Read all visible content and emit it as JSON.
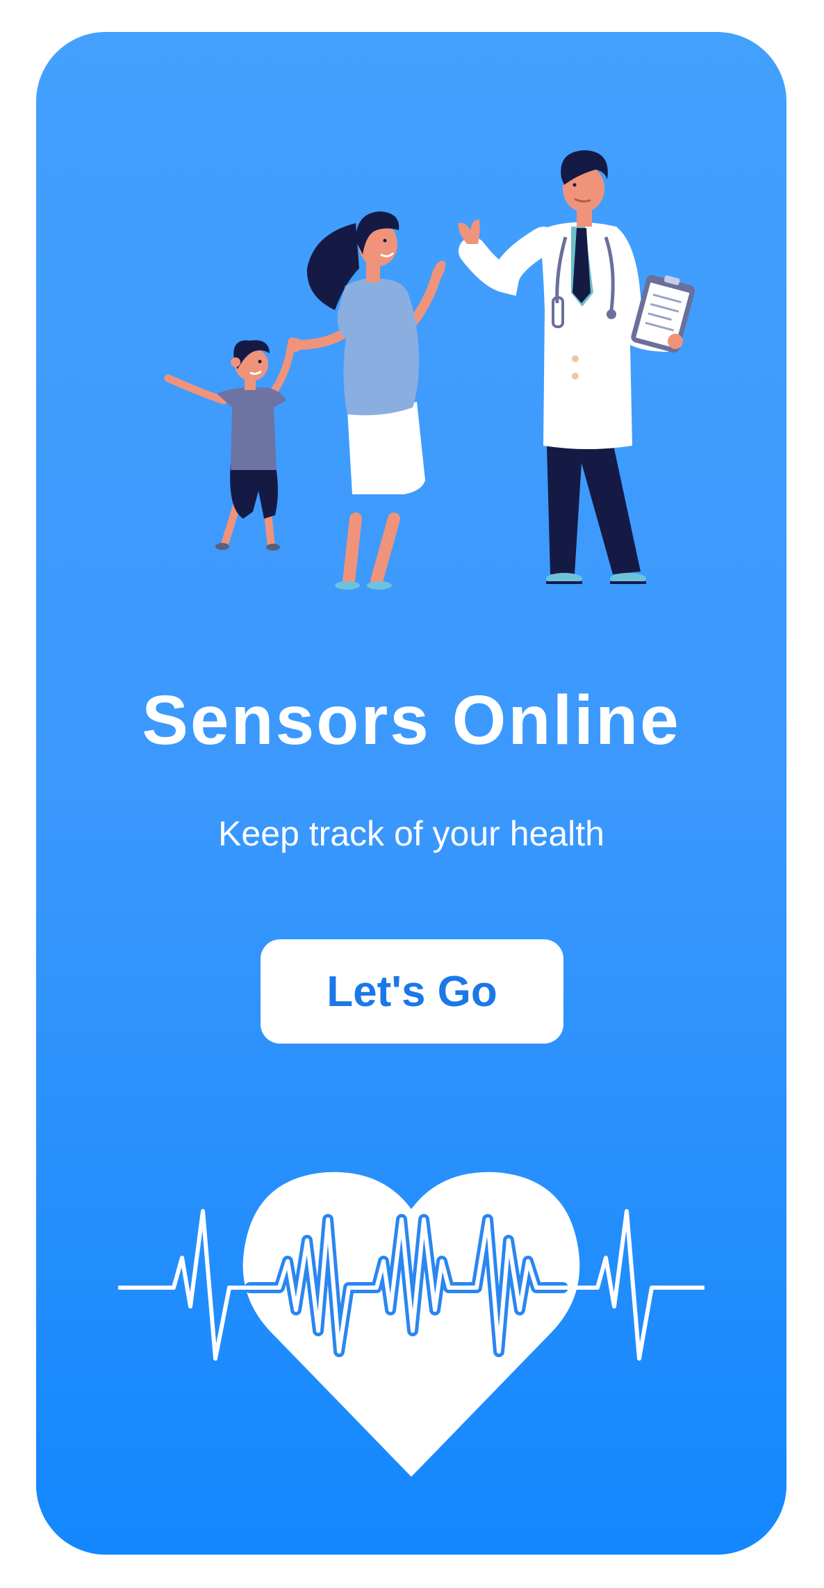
{
  "app": {
    "title": "Sensors Online",
    "subtitle": "Keep track of your health",
    "cta_label": "Let's Go"
  },
  "illustration": {
    "subject": "family-with-doctor",
    "icons": [
      "child-figure",
      "mother-figure",
      "doctor-figure",
      "stethoscope-icon",
      "clipboard-icon"
    ]
  },
  "footer_graphic": {
    "icons": [
      "heart-icon",
      "heartbeat-line-icon"
    ]
  },
  "colors": {
    "background_top": "#43a0fd",
    "background_bottom": "#1387fd",
    "text": "#ffffff",
    "button_background": "#ffffff",
    "button_text": "#1a78e8"
  }
}
